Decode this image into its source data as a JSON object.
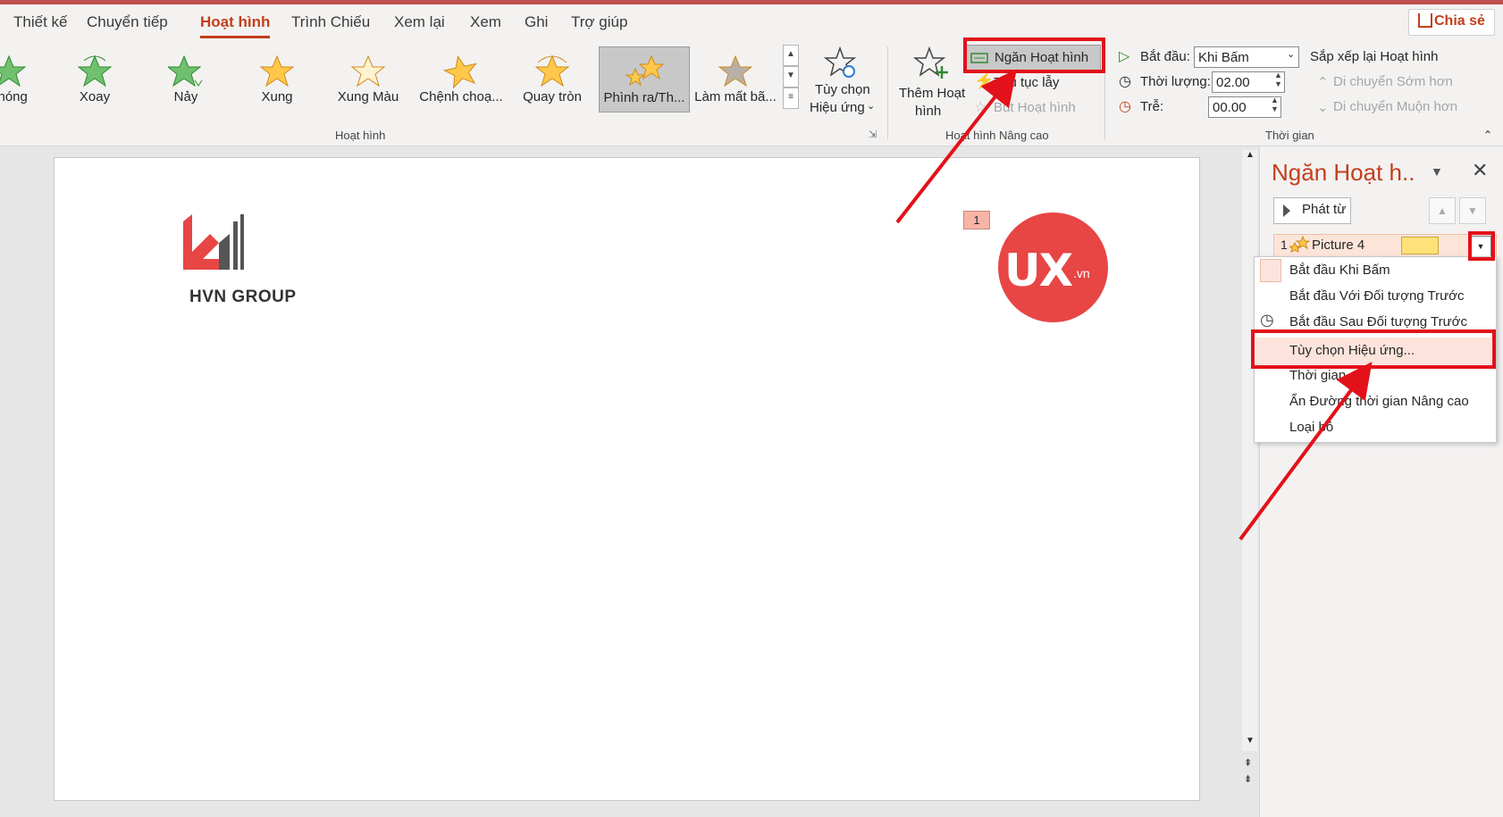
{
  "tabs": [
    "Thiết kế",
    "Chuyển tiếp",
    "Hoạt hình",
    "Trình Chiếu",
    "Xem lại",
    "Xem",
    "Ghi",
    "Trợ giúp"
  ],
  "share_label": "Chia sẻ",
  "gallery": [
    {
      "label": "phóng",
      "icon": "green-star-zoom-icon"
    },
    {
      "label": "Xoay",
      "icon": "green-star-spin-icon"
    },
    {
      "label": "Nảy",
      "icon": "green-star-bounce-icon"
    },
    {
      "label": "Xung",
      "icon": "orange-star-pulse-icon"
    },
    {
      "label": "Xung Màu",
      "icon": "orange-star-color-pulse-icon"
    },
    {
      "label": "Chệnh choạ...",
      "icon": "orange-star-teeter-icon"
    },
    {
      "label": "Quay tròn",
      "icon": "orange-star-spin-icon"
    },
    {
      "label": "Phình ra/Th...",
      "icon": "orange-stars-grow-shrink-icon"
    },
    {
      "label": "Làm mất bã...",
      "icon": "grey-star-desaturate-icon"
    }
  ],
  "effect_options": {
    "line1": "Tùy chọn",
    "line2": "Hiệu ứng"
  },
  "group_animation": "Hoạt hình",
  "add_animation": {
    "line1": "Thêm Hoạt",
    "line2": "hình"
  },
  "animation_pane_btn": "Ngăn Hoạt hình",
  "trigger": "Thủ tục lẫy",
  "animation_painter": "Bút Hoạt hình",
  "group_advanced": "Hoạt hình Nâng cao",
  "timing": {
    "start_label": "Bắt đầu:",
    "start_value": "Khi Bấm",
    "duration_label": "Thời lượng:",
    "duration_value": "02.00",
    "delay_label": "Trễ:",
    "delay_value": "00.00",
    "reorder_label": "Sắp xếp lại Hoạt hình",
    "move_earlier": "Di chuyển Sớm hơn",
    "move_later": "Di chuyển Muộn hơn",
    "group_label": "Thời gian"
  },
  "slide": {
    "hvn_text": "HVN GROUP",
    "ux_text": "UX",
    "ux_suffix": ".vn",
    "anim_tag": "1"
  },
  "pane": {
    "title": "Ngăn Hoạt h..",
    "play_from": "Phát từ",
    "item_number": "1",
    "item_name": "Picture 4"
  },
  "menu": [
    "Bắt đầu Khi Bấm",
    "Bắt đầu Với Đối tượng Trước",
    "Bắt đầu Sau Đối tượng Trước",
    "Tùy chọn Hiệu ứng...",
    "Thời gian...",
    "Ẩn Đường thời gian Nâng cao",
    "Loại bỏ"
  ],
  "colors": {
    "accent": "#c43e1c",
    "annotation": "#e3111a",
    "ux_red": "#e84545"
  }
}
